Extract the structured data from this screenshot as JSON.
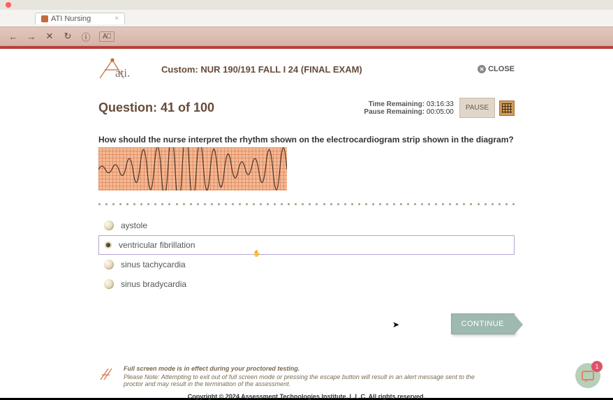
{
  "tab": {
    "title": "ATI Nursing"
  },
  "exam": {
    "title": "Custom: NUR 190/191 FALL I 24 (FINAL EXAM)"
  },
  "close": {
    "label": "CLOSE"
  },
  "question": {
    "counter": "Question: 41 of 100",
    "text": "How should the nurse interpret the rhythm shown on the electrocardiogram strip shown in the diagram?"
  },
  "timers": {
    "time_remaining_label": "Time Remaining:",
    "time_remaining_value": "03:16:33",
    "pause_remaining_label": "Pause Remaining:",
    "pause_remaining_value": "00:05:00"
  },
  "pause": {
    "label": "PAUSE"
  },
  "options": [
    {
      "label": "aystole",
      "selected": false
    },
    {
      "label": "ventricular fibrillation",
      "selected": true
    },
    {
      "label": "sinus tachycardia",
      "selected": false
    },
    {
      "label": "sinus bradycardia",
      "selected": false
    }
  ],
  "continue": {
    "label": "CONTINUE"
  },
  "footer": {
    "note1": "Full screen mode is in effect during your proctored testing.",
    "note2": "Please Note: Attempting to exit out of full screen mode or pressing the escape button will result in an alert message sent to the proctor and may result in the termination of the assessment.",
    "copyright": "Copyright © 2024 Assessment Technologies Institute, L.L.C. All rights reserved."
  },
  "chat": {
    "badge": "1"
  }
}
